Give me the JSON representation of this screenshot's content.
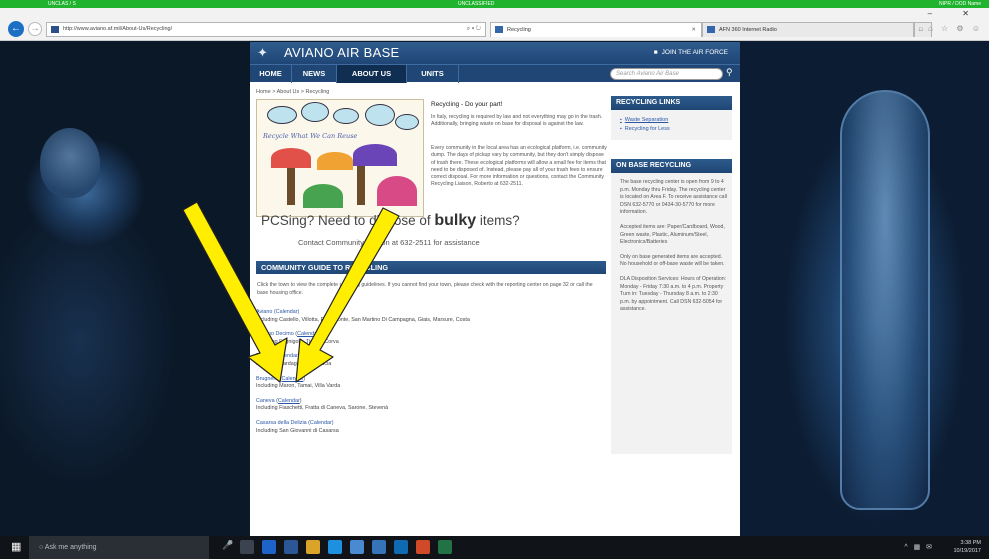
{
  "banner": {
    "left": "UNCLAS / S",
    "center": "UNCLASSIFIED",
    "right": "NIPR / DOD Name"
  },
  "browser": {
    "window_controls": "– ✕",
    "address": "http://www.aviano.af.mil/About-Us/Recycling/",
    "address_tools": "⌕ ▾ ↻",
    "tabs": [
      {
        "label": "Recycling",
        "active": true
      },
      {
        "label": "AFN 360 Internet Radio",
        "active": false
      }
    ],
    "new_tab": "□",
    "tools_icons": "⌂ ☆ ⚙ ☺"
  },
  "site": {
    "title": "AVIANO AIR BASE",
    "join_label": "JOIN THE AIR FORCE",
    "nav": [
      "HOME",
      "NEWS",
      "ABOUT US",
      "UNITS"
    ],
    "search_placeholder": "Search Aviano Air Base",
    "breadcrumb": "Home > About Us > Recycling",
    "drawing_caption": "Recycle What We Can Reuse",
    "intro_title": "Recycling - Do your part!",
    "paragraphs": [
      "In Italy, recycling is required by law and not everything may go in the trash. Additionally, bringing waste on base for disposal is against the law.",
      "Every community in the local area has an ecological platform, i.e. community dump. The days of pickup vary by community, but they don't simply dispose of trash there. These ecological platforms will allow a small fee for items that need to be disposed of. Instead, please pay all of your trash fees to ensure correct disposal. For more information or questions, contact the Community Recycling Liaison, Roberto at 632-2511."
    ],
    "pcs_pre": "PCSing? Need to dispose of ",
    "pcs_bold": "bulky",
    "pcs_post": " items?",
    "contact": "Contact Community Liaison at 632-2511 for assistance",
    "guide_header": "COMMUNITY GUIDE TO RECYCLING",
    "guide_intro": "Click the town to view the complete recycling guidelines. If you cannot find your town, please check with the reporting center on page 32 or call the base housing office.",
    "towns": [
      {
        "name": "Aviano (Calendar)",
        "cal": "",
        "desc": "Including Castello, Villotta, Pedemonte, San Martino Di Campagna, Giais, Marsure, Costa"
      },
      {
        "name": "Azzano Decimo",
        "cal": "Calendar",
        "desc": "Including Fagnigola, Tiezzo, Corva"
      },
      {
        "name": "Budoia (Calendar)",
        "cal": "",
        "desc": "Including Dardago, Santa Lucia"
      },
      {
        "name": "Brugnera",
        "cal": "Calendar",
        "desc": "Including Maron, Tamai, Villa Varda"
      },
      {
        "name": "Caneva",
        "cal": "Calendar",
        "desc": "Including Fiaschetti, Fratta di Caneva, Sarone, Stevenà"
      },
      {
        "name": "Cordenons",
        "cal": "",
        "desc": ""
      },
      {
        "name": "Casarsa della Delizia (Calendar)",
        "cal": "",
        "desc": "Including San Giovanni di Casarsa"
      }
    ],
    "links_header": "RECYCLING LINKS",
    "links": [
      "Waste Separation",
      "Recycling for Less"
    ],
    "onbase_header": "ON BASE RECYCLING",
    "onbase_paragraphs": [
      "The base recycling center is open from 9 to 4 p.m. Monday thru Friday. The recycling center is located on Area F. To receive assistance call DSN 632-5770 or 0434-30-5770 for more information.",
      "Accepted items are: Paper/Cardboard, Wood, Green waste, Plastic, Aluminum/Steel, Electronics/Batteries",
      "Only on base generated items are accepted. No household or off-base waste will be taken.",
      "DLA Disposition Services: Hours of Operation: Monday - Friday 7:30 a.m. to 4 p.m. Property Turn in: Tuesday - Thursday 8 a.m. to 2:30 p.m. by appointment. Call DSN 632-5054 for assistance."
    ]
  },
  "taskbar": {
    "search_placeholder": "Ask me anything",
    "tray_icons": "^ ▦ ✉",
    "time": "3:38 PM",
    "date": "10/19/2017"
  },
  "colors": {
    "nav_blue": "#1f4675",
    "banner_green": "#1fb32e",
    "arrow_yellow": "#ffee00"
  }
}
